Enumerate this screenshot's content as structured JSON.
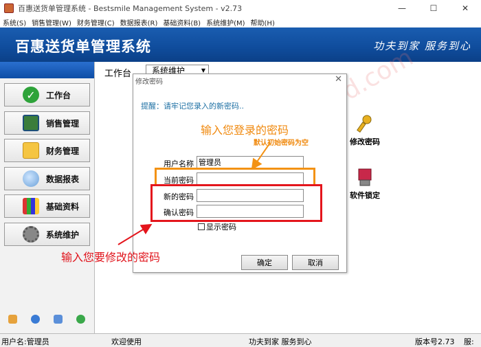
{
  "window": {
    "title": "百惠送货单管理系统 - Bestsmile Management System - v2.73",
    "minimize": "—",
    "maximize": "☐",
    "close": "✕"
  },
  "menubar": [
    "系统(S)",
    "销售管理(W)",
    "财务管理(C)",
    "数据报表(R)",
    "基础资料(B)",
    "系统维护(M)",
    "帮助(H)"
  ],
  "banner": {
    "title": "百惠送货单管理系统",
    "slogan": "功夫到家 服务到心"
  },
  "sidebar": {
    "items": [
      {
        "label": "工作台",
        "icon": "check-icon"
      },
      {
        "label": "销售管理",
        "icon": "sales-icon"
      },
      {
        "label": "财务管理",
        "icon": "folder-icon"
      },
      {
        "label": "数据报表",
        "icon": "magnifier-icon"
      },
      {
        "label": "基础资料",
        "icon": "chart-icon"
      },
      {
        "label": "系统维护",
        "icon": "gear-icon"
      }
    ]
  },
  "main": {
    "tab_label": "工作台",
    "tab_select": "系统维护",
    "tiles": [
      {
        "label": "修改密码",
        "icon": "key-icon"
      },
      {
        "label": "软件锁定",
        "icon": "lock-icon"
      }
    ]
  },
  "dialog": {
    "title": "修改密码",
    "close": "✕",
    "hint": "提醒：请牢记您录入的新密码..",
    "username_label": "用户名称",
    "username_value": "管理员",
    "current_label": "当前密码",
    "current_value": "",
    "new_label": "新的密码",
    "new_value": "",
    "confirm_label": "确认密码",
    "confirm_value": "",
    "show_password": "显示密码",
    "ok": "确定",
    "cancel": "取消"
  },
  "annotations": {
    "enter_login_password": "输入您登录的密码",
    "default_empty": "默认初始密码为空",
    "enter_new_password": "输入您要修改的密码",
    "watermark": "www.baoded.com"
  },
  "statusbar": {
    "user": "用户名:管理员",
    "welcome": "欢迎使用",
    "slogan": "功夫到家 服务到心",
    "version": "版本号2.73",
    "extra": "服:"
  },
  "colors": {
    "banner": "#0f4c9c",
    "annotation_orange": "#f39214",
    "annotation_red": "#e4151c",
    "hint": "#1c6fa3"
  }
}
